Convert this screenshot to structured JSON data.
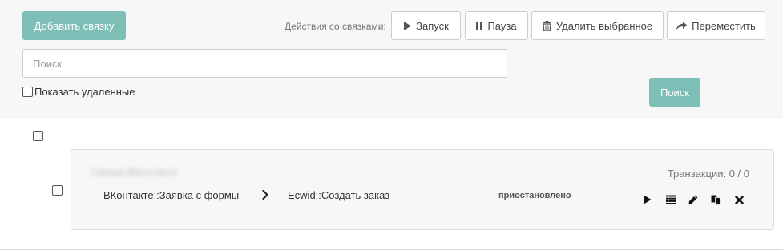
{
  "toolbar": {
    "add_label": "Добавить связку",
    "actions_label": "Действия со связками:",
    "start_label": "Запуск",
    "pause_label": "Пауза",
    "delete_label": "Удалить выбранное",
    "move_label": "Переместить"
  },
  "search": {
    "placeholder": "Поиск",
    "value": "",
    "button_label": "Поиск",
    "show_deleted_label": "Показать удаленные"
  },
  "bundles": [
    {
      "name": "Связка ВКонтакте",
      "transactions": "Транзакции: 0 / 0",
      "source": "ВКонтакте::Заявка с формы",
      "target": "Ecwid::Создать заказ",
      "status": "приостановлено",
      "actions": [
        "play-icon",
        "list-icon",
        "pencil-icon",
        "copy-icon",
        "close-icon"
      ]
    }
  ],
  "colors": {
    "accent": "#7dbfb6",
    "panel_bg": "#f7f7f7",
    "border": "#dcdcdc"
  }
}
